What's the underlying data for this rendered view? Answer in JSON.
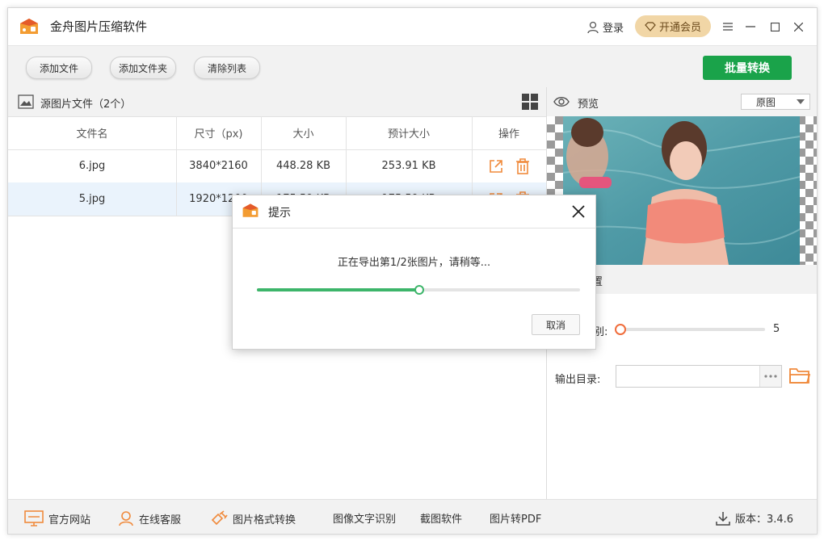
{
  "app": {
    "title": "金舟图片压缩软件",
    "login_label": "登录",
    "vip_label": "开通会员"
  },
  "toolbar": {
    "add_file": "添加文件",
    "add_folder": "添加文件夹",
    "clear_list": "清除列表",
    "batch_convert": "批量转换"
  },
  "source_panel": {
    "title": "源图片文件（2个）",
    "columns": [
      "文件名",
      "尺寸（px)",
      "大小",
      "预计大小",
      "操作"
    ],
    "rows": [
      {
        "name": "6.jpg",
        "size_px": "3840*2160",
        "size": "448.28 KB",
        "est_size": "253.91 KB"
      },
      {
        "name": "5.jpg",
        "size_px": "1920*1200",
        "size": "175.59 KB",
        "est_size": "175.59 KB"
      }
    ]
  },
  "preview": {
    "title": "预览",
    "mode_selected": "原图"
  },
  "settings": {
    "header_partial": "置",
    "quality_label_partial": "别:",
    "quality_value": "5",
    "output_dir_label": "输出目录:",
    "output_dir_value": ""
  },
  "dialog": {
    "title": "提示",
    "message": "正在导出第1/2张图片，请稍等...",
    "progress": 0.5,
    "cancel_label": "取消"
  },
  "footer": {
    "links": [
      "官方网站",
      "在线客服",
      "图片格式转换",
      "图像文字识别",
      "截图软件",
      "图片转PDF"
    ],
    "version_label": "版本：3.4.6"
  },
  "colors": {
    "accent_green": "#1aa34a",
    "progress_green": "#3db56a",
    "orange_icon": "#f08a3c",
    "vip_gold": "#f1d6a6"
  }
}
